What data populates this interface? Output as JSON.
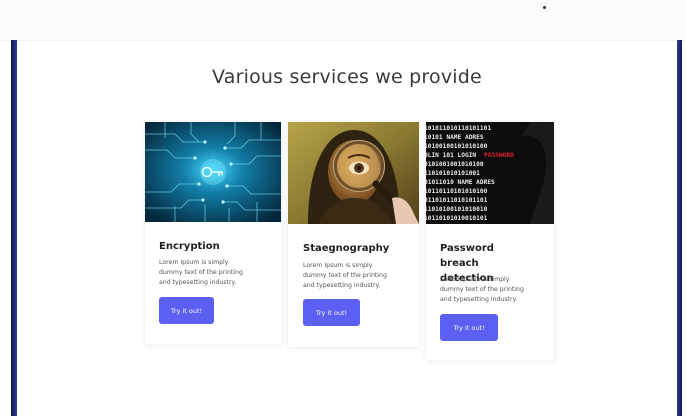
{
  "section": {
    "title": "Various services we provide"
  },
  "cards": [
    {
      "title": "Encryption",
      "description": "Lorem Ipsum is simply dummy text of the printing and typesetting industry.",
      "button_label": "Try it out!",
      "image_icon": "circuit-key-icon"
    },
    {
      "title": "Staegnography",
      "description": "Lorem Ipsum is simply dummy text of the printing and typesetting industry.",
      "button_label": "Try it out!",
      "image_icon": "magnifier-painting-icon"
    },
    {
      "title": "Password breach detection",
      "description": "Lorem Ipsum is simply dummy text of the printing and typesetting industry.",
      "button_label": "Try it out!",
      "image_icon": "binary-password-icon"
    }
  ],
  "colors": {
    "accent": "#5b5ff2",
    "frame": "#1c2a6e",
    "heading": "#3a3a3a"
  }
}
